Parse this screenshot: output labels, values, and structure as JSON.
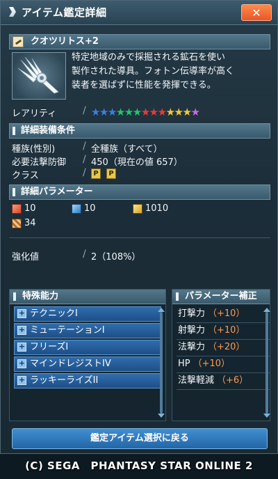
{
  "window": {
    "title": "アイテム鑑定詳細",
    "close_label": "✕"
  },
  "item": {
    "name": "クオツリトス+2",
    "description": [
      "特定地域のみで採掘される鉱石を使い",
      "製作された導具。フォトン伝導率が高く",
      "装者を選ばずに性能を発揮できる。"
    ],
    "rarity_label": "レアリティ",
    "rarity_stars": 13
  },
  "conditions": {
    "header": "詳細装備条件",
    "rows": [
      {
        "label": "種族(性別)",
        "value": "全種族（すべて）"
      },
      {
        "label": "必要法撃防御",
        "value": "450（現在の値 657）"
      },
      {
        "label": "クラス",
        "value": ""
      }
    ],
    "class_icons": [
      "P",
      "P"
    ]
  },
  "parameters": {
    "header": "詳細パラメーター",
    "values": [
      "10",
      "10",
      "1010",
      "34"
    ],
    "enhance_label": "強化値",
    "enhance_value": "2（108%）"
  },
  "abilities": {
    "header": "特殊能力",
    "items": [
      "テクニックI",
      "ミューテーションI",
      "フリーズI",
      "マインドレジストIV",
      "ラッキーライズII"
    ]
  },
  "bonus": {
    "header": "パラメーター補正",
    "items": [
      {
        "label": "打撃力",
        "value": "（+10）"
      },
      {
        "label": "射撃力",
        "value": "（+10）"
      },
      {
        "label": "法撃力",
        "value": "（+20）"
      },
      {
        "label": "HP",
        "value": "（+10）"
      },
      {
        "label": "法撃軽減",
        "value": "（+6）"
      }
    ]
  },
  "footer": {
    "back_button": "鑑定アイテム選択に戻る",
    "copyright": "(C) SEGA　PHANTASY STAR ONLINE 2"
  },
  "colors": {
    "accent_orange": "#ff9a52",
    "close_button": "#e9572a",
    "ability_blue": "#2f6dae"
  }
}
